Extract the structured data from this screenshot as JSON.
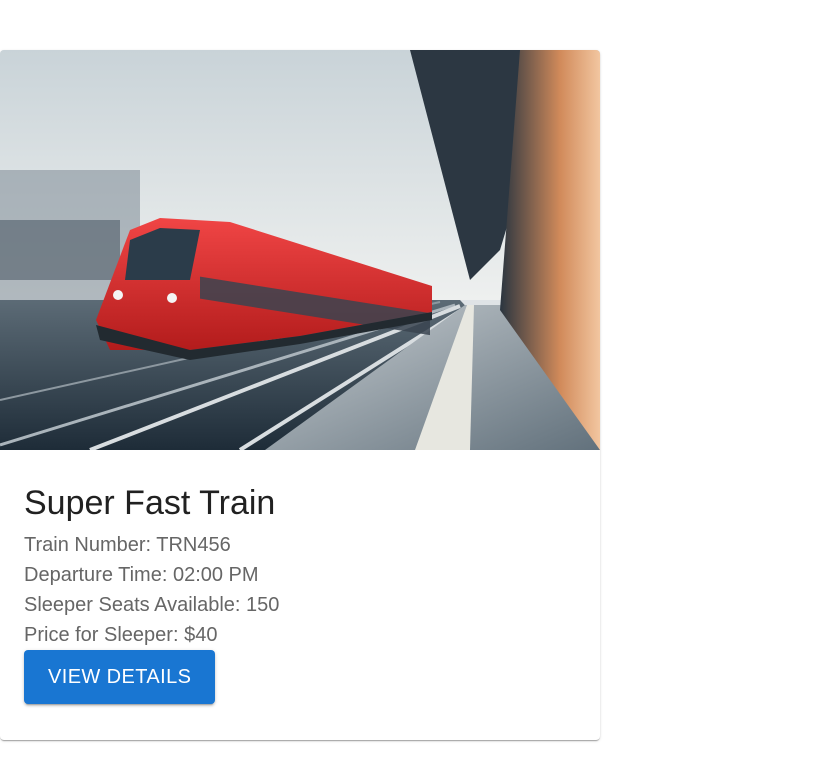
{
  "card": {
    "title": "Super Fast Train",
    "details": [
      "Train Number: TRN456",
      "Departure Time: 02:00 PM",
      "Sleeper Seats Available: 150",
      "Price for Sleeper: $40"
    ],
    "button_label": "View Details"
  },
  "colors": {
    "button": "#1976d2",
    "train": "#e32b2b"
  }
}
